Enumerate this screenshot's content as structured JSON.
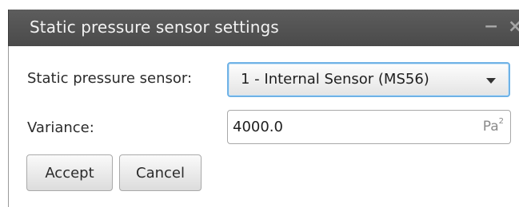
{
  "window": {
    "title": "Static pressure sensor settings",
    "minimize_glyph": "−",
    "close_glyph": "×"
  },
  "form": {
    "sensor_label": "Static pressure sensor:",
    "sensor_selected": "1 - Internal Sensor (MS56)",
    "variance_label": "Variance:",
    "variance_value": "4000.0",
    "variance_unit": "Pa",
    "variance_unit_exponent": "2"
  },
  "buttons": {
    "accept": "Accept",
    "cancel": "Cancel"
  },
  "colors": {
    "titlebar": "#4f4f4f",
    "focus_border": "#6fb2e6"
  },
  "icons": {
    "dropdown": "chevron-down-icon",
    "minimize": "minimize-icon",
    "close": "close-icon"
  }
}
